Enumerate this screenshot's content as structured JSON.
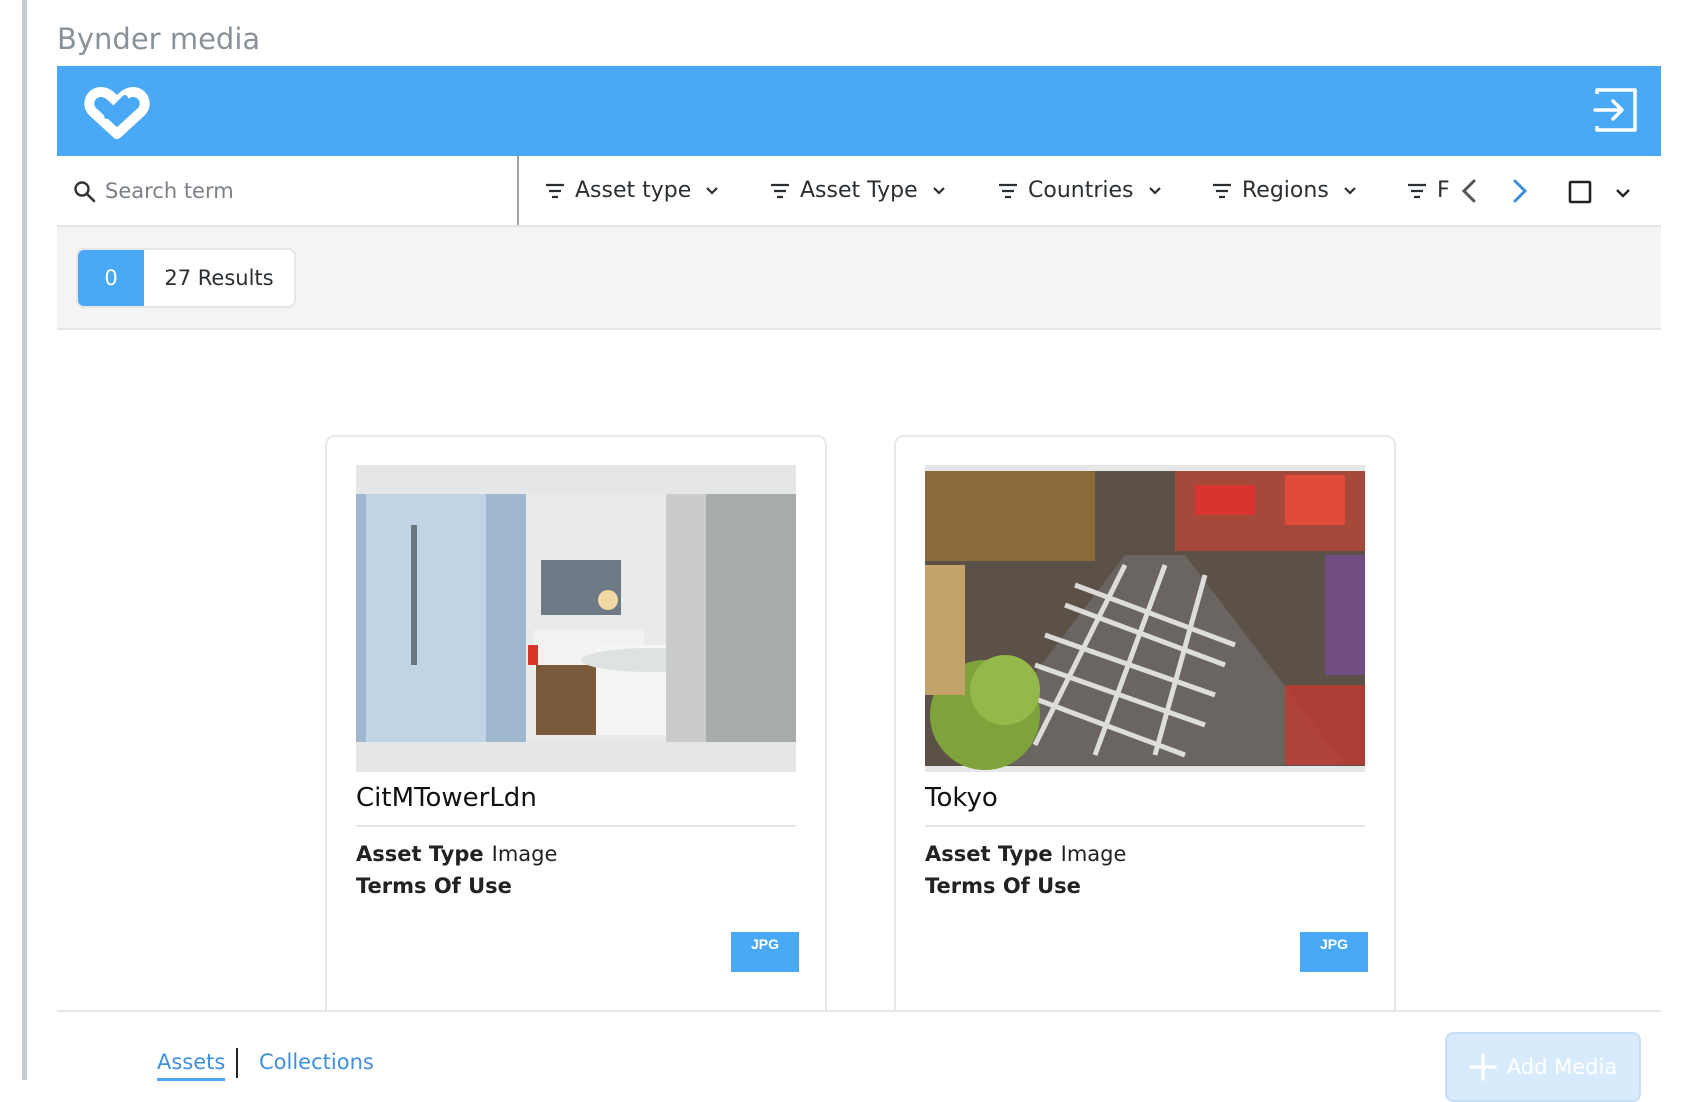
{
  "field_label": "Bynder media",
  "header": {
    "logo_icon": "bynder-logo-icon",
    "logout_icon": "sign-in-icon",
    "brand_color": "#49a9f6"
  },
  "search": {
    "placeholder": "Search term",
    "value": ""
  },
  "filters": [
    {
      "label": "Asset type"
    },
    {
      "label": "Asset Type"
    },
    {
      "label": "Countries"
    },
    {
      "label": "Regions"
    },
    {
      "label": "F"
    }
  ],
  "results": {
    "selected_count": "0",
    "results_label": "27 Results"
  },
  "assets": [
    {
      "title": "CitMTowerLdn",
      "asset_type_label": "Asset Type",
      "asset_type": "Image",
      "terms_label": "Terms Of Use",
      "badge": "JPG"
    },
    {
      "title": "Tokyo",
      "asset_type_label": "Asset Type",
      "asset_type": "Image",
      "terms_label": "Terms Of Use",
      "badge": "JPG"
    }
  ],
  "footer": {
    "tabs": [
      {
        "label": "Assets",
        "active": true
      },
      {
        "label": "Collections",
        "active": false
      }
    ],
    "add_media_label": "Add Media"
  }
}
